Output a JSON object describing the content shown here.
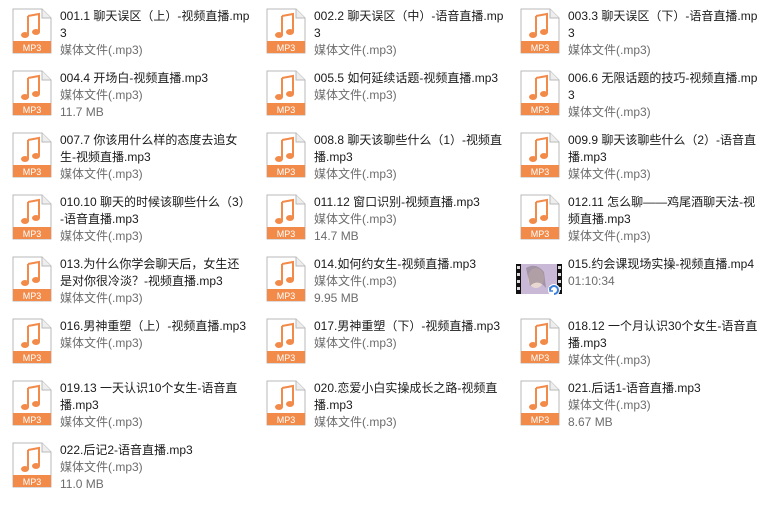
{
  "type_label_mp3": "MP3",
  "colors": {
    "accent": "#f28b4a",
    "meta_text": "#6d6d6d"
  },
  "files": [
    {
      "name": "001.1 聊天误区（上）-视频直播.mp3",
      "meta": "媒体文件(.mp3)",
      "icon": "mp3-audio-icon"
    },
    {
      "name": "002.2 聊天误区（中）-语音直播.mp3",
      "meta": "媒体文件(.mp3)",
      "icon": "mp3-audio-icon"
    },
    {
      "name": "003.3 聊天误区（下）-语音直播.mp3",
      "meta": "媒体文件(.mp3)",
      "icon": "mp3-audio-icon"
    },
    {
      "name": "004.4 开场白-视频直播.mp3",
      "meta": "媒体文件(.mp3)",
      "size": "11.7 MB",
      "icon": "mp3-audio-icon"
    },
    {
      "name": "005.5 如何延续话题-视频直播.mp3",
      "meta": "媒体文件(.mp3)",
      "icon": "mp3-audio-icon"
    },
    {
      "name": "006.6 无限话题的技巧-视频直播.mp3",
      "meta": "媒体文件(.mp3)",
      "icon": "mp3-audio-icon"
    },
    {
      "name": "007.7 你该用什么样的态度去追女生-视频直播.mp3",
      "meta": "媒体文件(.mp3)",
      "icon": "mp3-audio-icon"
    },
    {
      "name": "008.8 聊天该聊些什么（1）-视频直播.mp3",
      "meta": "媒体文件(.mp3)",
      "icon": "mp3-audio-icon"
    },
    {
      "name": "009.9 聊天该聊些什么（2）-语音直播.mp3",
      "meta": "媒体文件(.mp3)",
      "icon": "mp3-audio-icon"
    },
    {
      "name": "010.10 聊天的时候该聊些什么（3）-语音直播.mp3",
      "meta": "媒体文件(.mp3)",
      "icon": "mp3-audio-icon"
    },
    {
      "name": "011.12 窗口识别-视频直播.mp3",
      "meta": "媒体文件(.mp3)",
      "size": "14.7 MB",
      "icon": "mp3-audio-icon"
    },
    {
      "name": "012.11 怎么聊——鸡尾酒聊天法-视频直播.mp3",
      "meta": "媒体文件(.mp3)",
      "icon": "mp3-audio-icon"
    },
    {
      "name": "013.为什么你学会聊天后，女生还是对你很冷淡？-视频直播.mp3",
      "meta": "媒体文件(.mp3)",
      "icon": "mp3-audio-icon"
    },
    {
      "name": "014.如何约女生-视频直播.mp3",
      "meta": "媒体文件(.mp3)",
      "size": "9.95 MB",
      "icon": "mp3-audio-icon"
    },
    {
      "name": "015.约会课现场实操-视频直播.mp4",
      "meta": "01:10:34",
      "icon": "video-thumbnail-icon"
    },
    {
      "name": "016.男神重塑（上）-视频直播.mp3",
      "meta": "媒体文件(.mp3)",
      "icon": "mp3-audio-icon"
    },
    {
      "name": "017.男神重塑（下）-视频直播.mp3",
      "meta": "媒体文件(.mp3)",
      "icon": "mp3-audio-icon"
    },
    {
      "name": "018.12 一个月认识30个女生-语音直播.mp3",
      "meta": "媒体文件(.mp3)",
      "icon": "mp3-audio-icon"
    },
    {
      "name": "019.13 一天认识10个女生-语音直播.mp3",
      "meta": "媒体文件(.mp3)",
      "icon": "mp3-audio-icon"
    },
    {
      "name": "020.恋爱小白实操成长之路-视频直播.mp3",
      "meta": "媒体文件(.mp3)",
      "icon": "mp3-audio-icon"
    },
    {
      "name": "021.后话1-语音直播.mp3",
      "meta": "媒体文件(.mp3)",
      "size": "8.67 MB",
      "icon": "mp3-audio-icon"
    },
    {
      "name": "022.后记2-语音直播.mp3",
      "meta": "媒体文件(.mp3)",
      "size": "11.0 MB",
      "icon": "mp3-audio-icon"
    }
  ]
}
